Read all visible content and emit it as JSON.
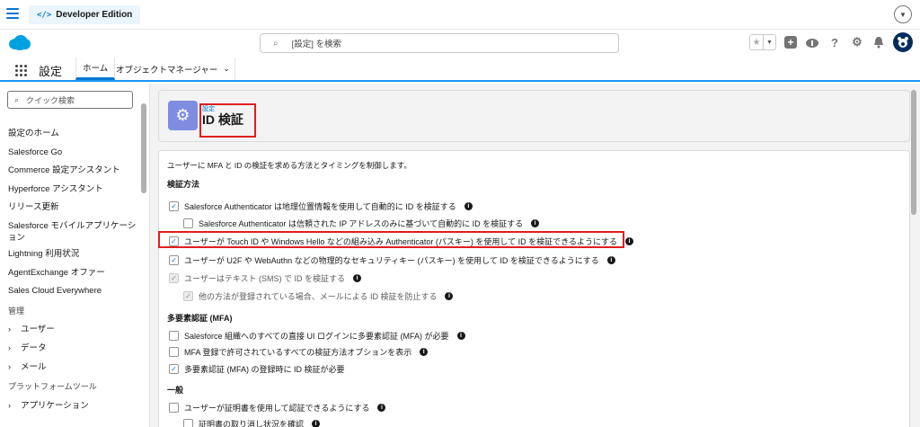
{
  "topbar": {
    "edition_label": "Developer Edition",
    "edition_icon": "code-icon"
  },
  "header": {
    "search_placeholder": "[設定] を検索"
  },
  "nav": {
    "app_name": "設定",
    "tab_home": "ホーム",
    "tab_object_manager": "オブジェクトマネージャー"
  },
  "sidebar": {
    "quick_find_placeholder": "クイック検索",
    "items": [
      {
        "label": "設定のホーム"
      },
      {
        "label": "Salesforce Go"
      },
      {
        "label": "Commerce 設定アシスタント"
      },
      {
        "label": "Hyperforce アシスタント"
      },
      {
        "label": "リリース更新"
      },
      {
        "label": "Salesforce モバイルアプリケーション"
      },
      {
        "label": "Lightning 利用状況"
      },
      {
        "label": "AgentExchange オファー"
      },
      {
        "label": "Sales Cloud Everywhere"
      }
    ],
    "admin_heading": "管理",
    "admin_items": [
      {
        "label": "ユーザー"
      },
      {
        "label": "データ"
      },
      {
        "label": "メール"
      }
    ],
    "platform_heading": "プラットフォームツール",
    "platform_items": [
      {
        "label": "アプリケーション"
      }
    ]
  },
  "page": {
    "breadcrumb": "設定",
    "title": "ID 検証",
    "intro": "ユーザーに MFA と ID の検証を求める方法とタイミングを制御します。",
    "section_methods": "検証方法",
    "methods": [
      {
        "label": "Salesforce Authenticator は地理位置情報を使用して自動的に ID を検証する",
        "checked": true,
        "disabled": false
      },
      {
        "label": "Salesforce Authenticator は信頼された IP アドレスのみに基づいて自動的に ID を検証する",
        "checked": false,
        "disabled": false
      },
      {
        "label": "ユーザーが Touch ID や Windows Hello などの組み込み Authenticator (パスキー) を使用して ID を検証できるようにする",
        "checked": true,
        "disabled": false
      },
      {
        "label": "ユーザーが U2F や WebAuthn などの物理的なセキュリティキー (パスキー) を使用して ID を検証できるようにする",
        "checked": true,
        "disabled": false
      },
      {
        "label": "ユーザーはテキスト (SMS) で ID を検証する",
        "checked": true,
        "disabled": true
      },
      {
        "label": "他の方法が登録されている場合、メールによる ID 検証を防止する",
        "checked": true,
        "disabled": true
      }
    ],
    "section_mfa": "多要素認証 (MFA)",
    "mfa": [
      {
        "label": "Salesforce 組織へのすべての直接 UI ログインに多要素認証 (MFA) が必要",
        "checked": false
      },
      {
        "label": "MFA 登録で許可されているすべての検証方法オプションを表示",
        "checked": false
      },
      {
        "label": "多要素認証 (MFA) の登録時に ID 検証が必要",
        "checked": true
      }
    ],
    "section_general": "一般",
    "general": [
      {
        "label": "ユーザーが証明書を使用して認証できるようにする",
        "checked": false
      },
      {
        "label": "証明書の取り消し状況を確認",
        "checked": false
      }
    ]
  },
  "colors": {
    "accent": "#0176d3",
    "highlight": "#e01e1e",
    "setup_icon": "#7f8de1"
  }
}
